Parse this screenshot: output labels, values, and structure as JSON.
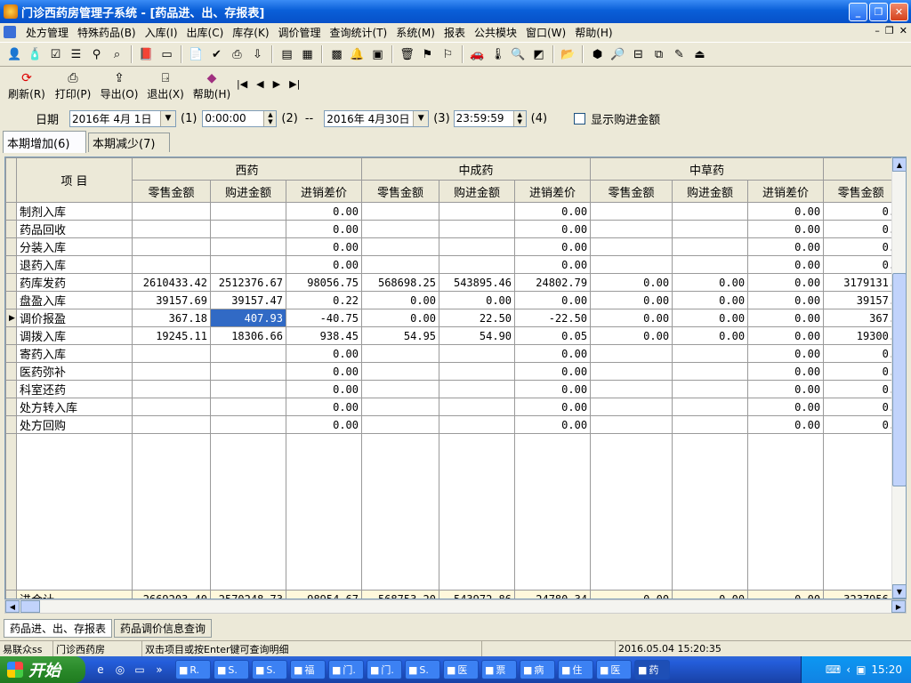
{
  "window": {
    "title": "门诊西药房管理子系统 - [药品进、出、存报表]"
  },
  "menu": [
    "处方管理",
    "特殊药品(B)",
    "入库(I)",
    "出库(C)",
    "库存(K)",
    "调价管理",
    "查询统计(T)",
    "系统(M)",
    "报表",
    "公共模块",
    "窗口(W)",
    "帮助(H)"
  ],
  "toolbar_icons": [
    "user-icon",
    "bottle-icon",
    "check-icon",
    "list-icon",
    "binoculars-icon",
    "search-doc-icon",
    "book-icon",
    "card-icon",
    "report-icon",
    "checklist-icon",
    "print-icon",
    "export-icon",
    "form-icon",
    "calc-icon",
    "grid-icon",
    "bell-icon",
    "calendar-icon",
    "trash-icon",
    "find-icon",
    "find2-icon",
    "car-icon",
    "thermometer-icon",
    "zoom-icon",
    "image-icon",
    "folder-icon",
    "stone-icon",
    "magnify-icon",
    "layout-icon",
    "windows-icon",
    "edit-icon",
    "exit-icon"
  ],
  "actions": {
    "refresh": "刷新(R)",
    "print": "打印(P)",
    "export": "导出(O)",
    "exit": "退出(X)",
    "help": "帮助(H)"
  },
  "filter": {
    "date_label": "日期",
    "start_date": "2016年 4月 1日",
    "step1": "(1)",
    "start_time": "0:00:00",
    "step2": "(2)",
    "dash": "--",
    "end_date": "2016年 4月30日",
    "step3": "(3)",
    "end_time": "23:59:59",
    "step4": "(4)",
    "show_purchase": "显示购进金额"
  },
  "tabs": [
    "本期增加(6)",
    "本期减少(7)"
  ],
  "grid": {
    "item_header": "项 目",
    "groups": [
      "西药",
      "中成药",
      "中草药"
    ],
    "subheaders": [
      "零售金额",
      "购进金额",
      "进销差价"
    ],
    "rows": [
      [
        "制剂入库",
        "",
        "",
        "0.00",
        "",
        "",
        "0.00",
        "",
        "",
        "0.00",
        "0."
      ],
      [
        "药品回收",
        "",
        "",
        "0.00",
        "",
        "",
        "0.00",
        "",
        "",
        "0.00",
        "0."
      ],
      [
        "分装入库",
        "",
        "",
        "0.00",
        "",
        "",
        "0.00",
        "",
        "",
        "0.00",
        "0."
      ],
      [
        "退药入库",
        "",
        "",
        "0.00",
        "",
        "",
        "0.00",
        "",
        "",
        "0.00",
        "0."
      ],
      [
        "药库发药",
        "2610433.42",
        "2512376.67",
        "98056.75",
        "568698.25",
        "543895.46",
        "24802.79",
        "0.00",
        "0.00",
        "0.00",
        "3179131."
      ],
      [
        "盘盈入库",
        "39157.69",
        "39157.47",
        "0.22",
        "0.00",
        "0.00",
        "0.00",
        "0.00",
        "0.00",
        "0.00",
        "39157."
      ],
      [
        "调价报盈",
        "367.18",
        "407.93",
        "-40.75",
        "0.00",
        "22.50",
        "-22.50",
        "0.00",
        "0.00",
        "0.00",
        "367."
      ],
      [
        "调拨入库",
        "19245.11",
        "18306.66",
        "938.45",
        "54.95",
        "54.90",
        "0.05",
        "0.00",
        "0.00",
        "0.00",
        "19300."
      ],
      [
        "寄药入库",
        "",
        "",
        "0.00",
        "",
        "",
        "0.00",
        "",
        "",
        "0.00",
        "0."
      ],
      [
        "医药弥补",
        "",
        "",
        "0.00",
        "",
        "",
        "0.00",
        "",
        "",
        "0.00",
        "0."
      ],
      [
        "科室还药",
        "",
        "",
        "0.00",
        "",
        "",
        "0.00",
        "",
        "",
        "0.00",
        "0."
      ],
      [
        "处方转入库",
        "",
        "",
        "0.00",
        "",
        "",
        "0.00",
        "",
        "",
        "0.00",
        "0."
      ],
      [
        "处方回购",
        "",
        "",
        "0.00",
        "",
        "",
        "0.00",
        "",
        "",
        "0.00",
        "0."
      ]
    ],
    "total": [
      "进合计",
      "2669203.40",
      "2570248.73",
      "98954.67",
      "568753.20",
      "543972.86",
      "24780.34",
      "0.00",
      "0.00",
      "0.00",
      "3237956."
    ]
  },
  "window_tabs": [
    "药品进、出、存报表",
    "药品调价信息查询"
  ],
  "status": {
    "user": "易联众ss",
    "dept": "门诊西药房",
    "hint": "双击项目或按Enter键可查询明细",
    "datetime": "2016.05.04 15:20:35"
  },
  "taskbar": {
    "start": "开始",
    "tasks": [
      "R.",
      "S.",
      "S.",
      "福",
      "门.",
      "门.",
      "S.",
      "医",
      "票",
      "病",
      "住",
      "医",
      "药"
    ],
    "time": "15:20"
  }
}
